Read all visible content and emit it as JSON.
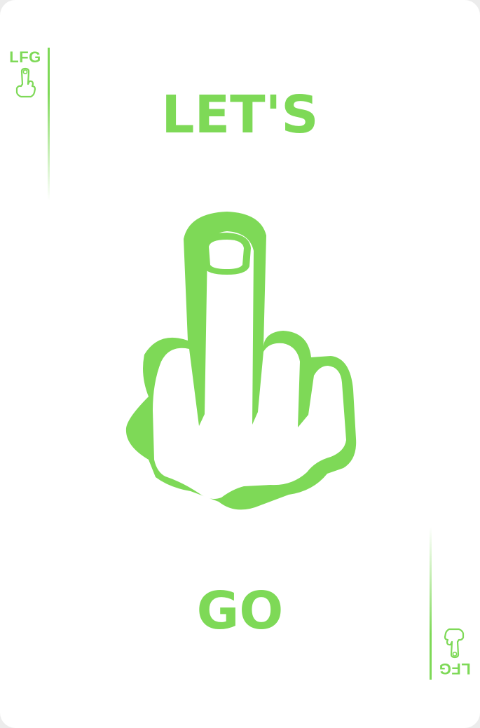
{
  "card": {
    "corner_label": "LFG",
    "top_text": "LET'S",
    "bottom_text": "GO",
    "icon": "middle-finger-hand-icon"
  },
  "colors": {
    "accent": "#7ed957",
    "background": "#ffffff"
  }
}
